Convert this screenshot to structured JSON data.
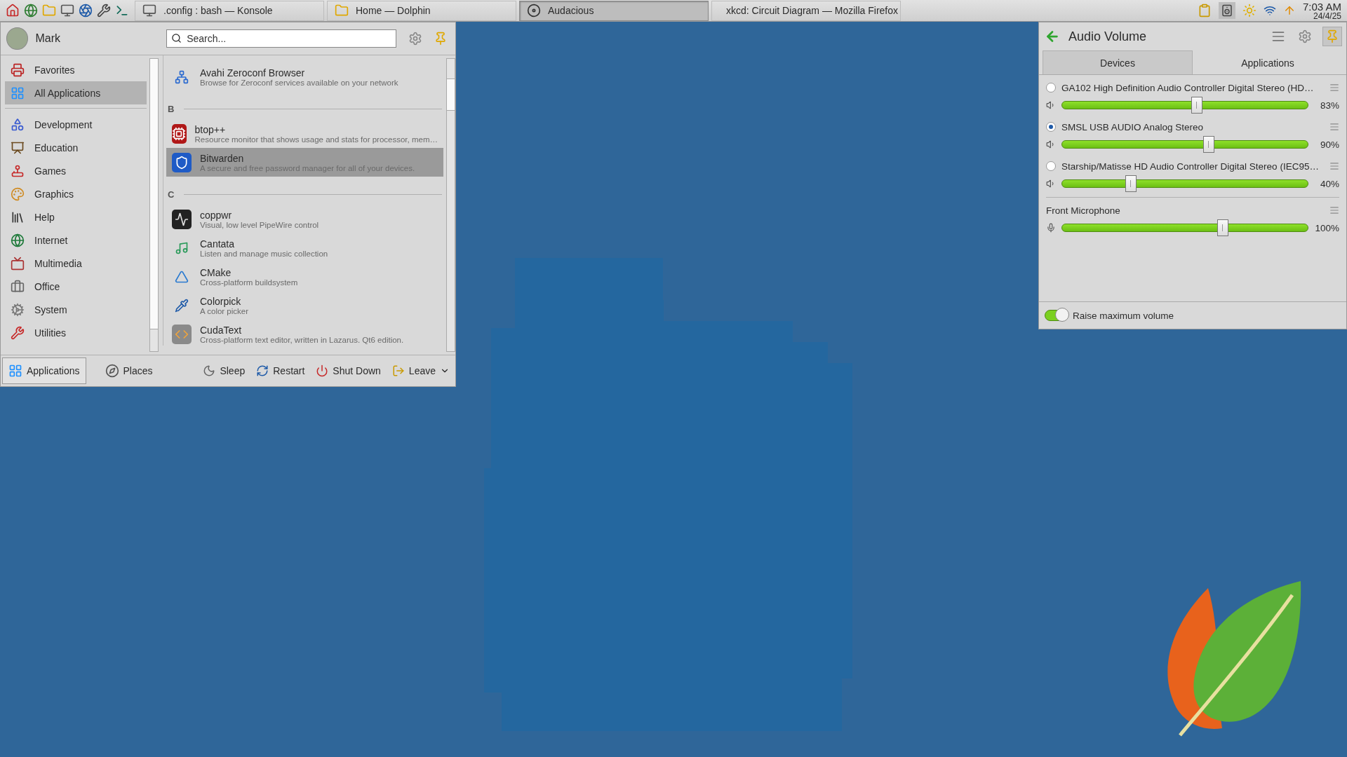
{
  "taskbar": {
    "tasks": [
      {
        "title": ".config : bash — Konsole",
        "selected": false
      },
      {
        "title": "Home — Dolphin",
        "selected": false
      },
      {
        "title": "Audacious",
        "selected": true
      },
      {
        "title": "xkcd: Circuit Diagram — Mozilla Firefox",
        "selected": false
      }
    ],
    "clock": {
      "time": "7:03 AM",
      "date": "24/4/25"
    }
  },
  "menu": {
    "user": {
      "name": "Mark"
    },
    "search": {
      "placeholder": "Search..."
    },
    "categories": [
      {
        "label": "Favorites",
        "selected": false
      },
      {
        "label": "All Applications",
        "selected": true
      },
      {
        "label": "Development",
        "selected": false
      },
      {
        "label": "Education",
        "selected": false
      },
      {
        "label": "Games",
        "selected": false
      },
      {
        "label": "Graphics",
        "selected": false
      },
      {
        "label": "Help",
        "selected": false
      },
      {
        "label": "Internet",
        "selected": false
      },
      {
        "label": "Multimedia",
        "selected": false
      },
      {
        "label": "Office",
        "selected": false
      },
      {
        "label": "System",
        "selected": false
      },
      {
        "label": "Utilities",
        "selected": false
      }
    ],
    "sections": [
      {
        "apps": [
          {
            "name": "Avahi Zeroconf Browser",
            "description": "Browse for Zeroconf services available on your network",
            "selected": false
          }
        ]
      },
      {
        "letter": "B",
        "apps": [
          {
            "name": "btop++",
            "description": "Resource monitor that shows usage and stats for processor, mem…",
            "selected": false
          },
          {
            "name": "Bitwarden",
            "description": "A secure and free password manager for all of your devices.",
            "selected": true
          }
        ]
      },
      {
        "letter": "C",
        "apps": [
          {
            "name": "coppwr",
            "description": "Visual, low level PipeWire control",
            "selected": false
          },
          {
            "name": "Cantata",
            "description": "Listen and manage music collection",
            "selected": false
          },
          {
            "name": "CMake",
            "description": "Cross-platform buildsystem",
            "selected": false
          },
          {
            "name": "Colorpick",
            "description": "A color picker",
            "selected": false
          },
          {
            "name": "CudaText",
            "description": "Cross-platform text editor, written in Lazarus. Qt6 edition.",
            "selected": false
          }
        ]
      }
    ],
    "views": [
      {
        "label": "Applications",
        "selected": true
      },
      {
        "label": "Places",
        "selected": false
      }
    ],
    "power": [
      {
        "label": "Sleep"
      },
      {
        "label": "Restart"
      },
      {
        "label": "Shut Down"
      },
      {
        "label": "Leave"
      }
    ]
  },
  "audio": {
    "title": "Audio Volume",
    "tabs": [
      {
        "label": "Devices",
        "selected": true
      },
      {
        "label": "Applications",
        "selected": false
      }
    ],
    "devices": [
      {
        "name": "GA102 High Definition Audio Controller Digital Stereo (HD…",
        "selected": false,
        "level": 0.55,
        "reading": "83%"
      },
      {
        "name": "SMSL USB AUDIO Analog Stereo",
        "selected": true,
        "level": 0.6,
        "reading": "90%"
      },
      {
        "name": "Starship/Matisse HD Audio Controller Digital Stereo (IEC95…",
        "selected": false,
        "level": 0.27,
        "reading": "40%"
      }
    ],
    "inputs": [
      {
        "name": "Front Microphone",
        "level": 0.66,
        "reading": "100%"
      }
    ],
    "raise_volume": {
      "label": "Raise maximum volume",
      "on": true
    }
  }
}
